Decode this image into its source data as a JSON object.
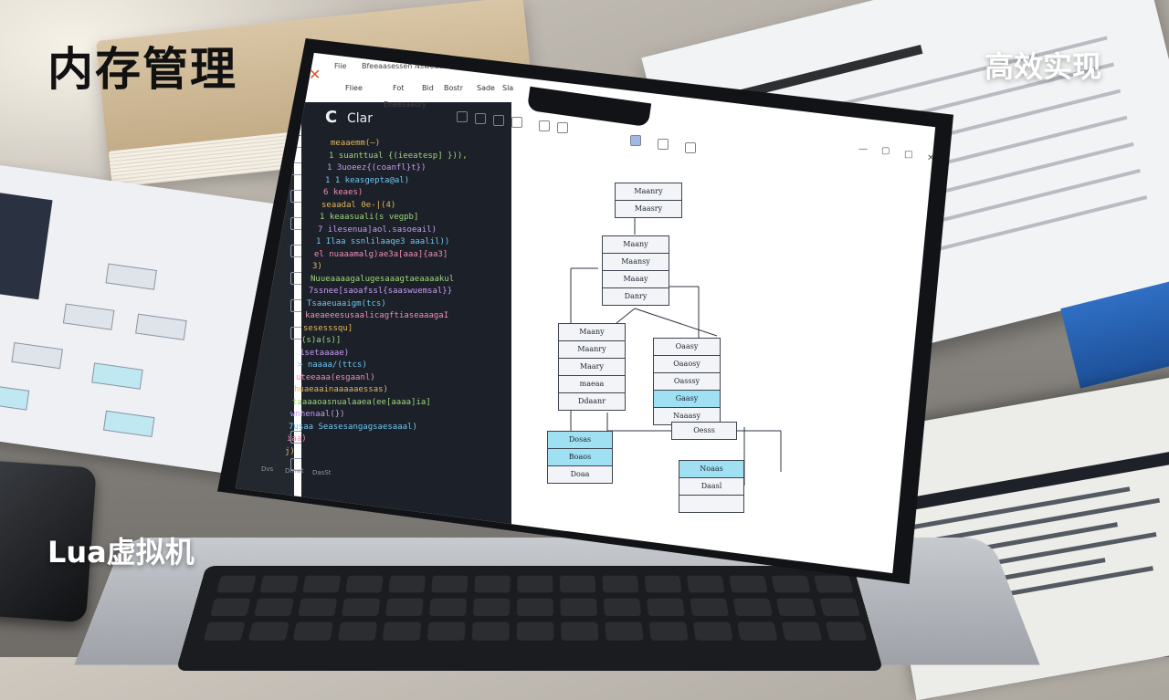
{
  "overlay": {
    "top_left_title": "内存管理",
    "top_right_title": "高效实现",
    "bottom_left_title": "Lua虚拟机"
  },
  "editor": {
    "language_title": "C",
    "language_subtitle": "Clar",
    "tab_title": "Bfeeaasessen Nsweetar",
    "tab_2": "Fiie",
    "menu": [
      "Fliee",
      "Fot",
      "Bid",
      "Bostr",
      "Sade",
      "Sla"
    ],
    "toolbar_label": "Eneesaaory",
    "status": [
      "Dvs",
      "Dmwt",
      "DasSt"
    ],
    "code_lines": [
      "meaaemm(—)",
      "1   suanttual {(ieeatesp] })),",
      "1   3uoeez{(coanfl}t})",
      "1   1 keasgepta@al)",
      "6   keaes)",
      "seaadal 0e-|(4)",
      "1   keaasuali(s vegpb]",
      "7   ilesenua]aol.sasoeail)",
      "1   Ilaa ssnlilaaqe3 aaalil))",
      "el  nuaaamalg)ae3a[aaa]{aa3]",
      "3)",
      "Nuueaaaagalugesaaagtaeaaaakul",
      "7ssnee[saoafssl{saaswuemsal}}",
      "Tsaaeuaaigm(tcs)",
      "kaeaeeesusaalicagftiaseaaagaI",
      "sesesssqu]",
      "(s)a(s)]",
      "1setaaaae)",
      "> naaaa/(ttcs)",
      "uteeaaa(esgaanl)",
      "huaeaainaaaaaessas)",
      "taaaaoasnualaaea(ee[aaaa]ia]",
      "wnhenaal(})",
      "7usaa   Seasesangagsaesaaal)",
      "iaa)",
      "j)"
    ]
  },
  "diagram": {
    "root": [
      "Maanry",
      "Maasry"
    ],
    "level1": [
      "Maany",
      "Maansy",
      "Maaay",
      "Danry"
    ],
    "left": [
      "Maany",
      "Maanry",
      "Maary",
      "maeaa",
      "Ddaanr"
    ],
    "right": [
      "Oaasy",
      "Oaaosy",
      "Oasssy",
      "Gaasy",
      "Naaasy"
    ],
    "connector": "Oesss",
    "bottom_left": [
      "Dosas",
      "Boaos",
      "Doaa"
    ],
    "bottom_right": [
      "Noaas",
      "Daasl",
      ""
    ]
  }
}
